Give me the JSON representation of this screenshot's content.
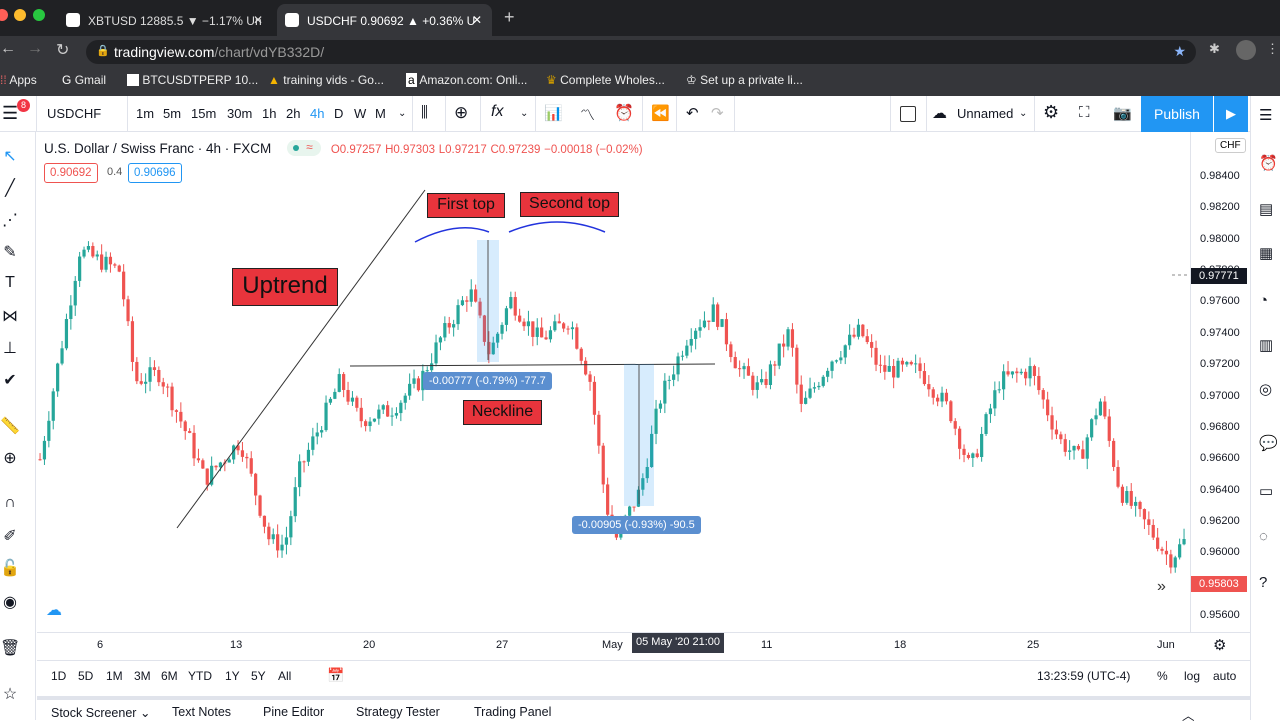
{
  "browser": {
    "tabs": [
      {
        "label": "XBTUSD 12885.5 ▼ −1.17% Un"
      },
      {
        "label": "USDCHF 0.90692 ▲ +0.36% U"
      }
    ],
    "url_domain": "tradingview.com",
    "url_path": "/chart/vdYB332D/",
    "bookmarks": [
      {
        "label": "Apps"
      },
      {
        "label": "Gmail"
      },
      {
        "label": "BTCUSDTPERP 10..."
      },
      {
        "label": "training vids - Go..."
      },
      {
        "label": "Amazon.com: Onli..."
      },
      {
        "label": "Complete Wholes..."
      },
      {
        "label": "Set up a private li..."
      }
    ]
  },
  "toolbar": {
    "notifications": "8",
    "symbol": "USDCHF",
    "intervals": [
      "1m",
      "5m",
      "15m",
      "30m",
      "1h",
      "2h",
      "4h",
      "D",
      "W",
      "M"
    ],
    "active_interval": "4h",
    "layout_name": "Unnamed",
    "publish": "Publish"
  },
  "legend": {
    "title": "U.S. Dollar / Swiss Franc · 4h · FXCM",
    "open": "O0.97257",
    "high": "H0.97303",
    "low": "L0.97217",
    "close": "C0.97239",
    "change": "−0.00018 (−0.02%)",
    "sell": "0.90692",
    "spread": "0.4",
    "buy": "0.90696"
  },
  "colors": {
    "up": "#26a69a",
    "down": "#ef5350",
    "accent": "#2196f3",
    "annotation": "#e8343c"
  },
  "annotations": {
    "uptrend": "Uptrend",
    "first_top": "First top",
    "second_top": "Second top",
    "neckline": "Neckline",
    "measure1": "-0.00777 (-0.79%) -77.7",
    "measure2": "-0.00905 (-0.93%) -90.5"
  },
  "chart_data": {
    "type": "candlestick",
    "symbol": "USDCHF",
    "timeframe": "4h",
    "y_ticks": [
      "0.98400",
      "0.98200",
      "0.98000",
      "0.97800",
      "0.97600",
      "0.97400",
      "0.97200",
      "0.97000",
      "0.96800",
      "0.96600",
      "0.96400",
      "0.96200",
      "0.96000",
      "0.95600"
    ],
    "ylim": [
      0.9555,
      0.9859
    ],
    "x_ticks": [
      "6",
      "13",
      "20",
      "27",
      "May",
      "11",
      "18",
      "25",
      "Jun"
    ],
    "crosshair_time": "05 May '20  21:00",
    "crosshair_price": "0.97771",
    "last_price": "0.95803",
    "currency": "CHF",
    "price_path": [
      [
        "2020-04-02T19",
        0.966
      ],
      [
        "2020-04-04T21",
        0.9793
      ],
      [
        "2020-04-07T00",
        0.978
      ],
      [
        "2020-04-07T19",
        0.971
      ],
      [
        "2020-04-09T02",
        0.9715
      ],
      [
        "2020-04-10T16",
        0.9672
      ],
      [
        "2020-04-11T11",
        0.9647
      ],
      [
        "2020-04-13T08",
        0.9672
      ],
      [
        "2020-04-14T21",
        0.9608
      ],
      [
        "2020-04-15T16",
        0.9605
      ],
      [
        "2020-04-16T11",
        0.9653
      ],
      [
        "2020-04-18T14",
        0.971
      ],
      [
        "2020-04-19T15",
        0.9685
      ],
      [
        "2020-04-21T05",
        0.9691
      ],
      [
        "2020-04-22T19",
        0.971
      ],
      [
        "2020-04-23T20",
        0.9736
      ],
      [
        "2020-04-25T10",
        0.9768
      ],
      [
        "2020-04-26T11",
        0.9727
      ],
      [
        "2020-04-27T13",
        0.9762
      ],
      [
        "2020-04-29T02",
        0.9736
      ],
      [
        "2020-04-30T16",
        0.9749
      ],
      [
        "2020-05-01T18",
        0.971
      ],
      [
        "2020-05-02T13",
        0.9634
      ],
      [
        "2020-05-03T01",
        0.9608
      ],
      [
        "2020-05-04T09",
        0.964
      ],
      [
        "2020-05-05T10",
        0.9698
      ],
      [
        "2020-05-07T00",
        0.9742
      ],
      [
        "2020-05-08T07",
        0.9755
      ],
      [
        "2020-05-09T14",
        0.9717
      ],
      [
        "2020-05-10T17",
        0.9704
      ],
      [
        "2020-05-12T06",
        0.9742
      ],
      [
        "2020-05-12T19",
        0.9691
      ],
      [
        "2020-05-14T09",
        0.9723
      ],
      [
        "2020-05-15T23",
        0.9742
      ],
      [
        "2020-05-17T00",
        0.9717
      ],
      [
        "2020-05-19T02",
        0.9717
      ],
      [
        "2020-05-20T16",
        0.9691
      ],
      [
        "2020-05-21T18",
        0.9653
      ],
      [
        "2020-05-23T07",
        0.971
      ],
      [
        "2020-05-24T22",
        0.9717
      ],
      [
        "2020-05-26T11",
        0.9672
      ],
      [
        "2020-05-27T12",
        0.966
      ],
      [
        "2020-05-28T14",
        0.9698
      ],
      [
        "2020-05-29T15",
        0.964
      ],
      [
        "2020-05-31T05",
        0.9615
      ],
      [
        "2020-06-01T06",
        0.9596
      ],
      [
        "2020-06-02T01",
        0.9608
      ],
      [
        "2020-06-02T07",
        0.958
      ]
    ],
    "neckline": 0.972
  },
  "range_buttons": [
    "1D",
    "5D",
    "1M",
    "3M",
    "6M",
    "YTD",
    "1Y",
    "5Y",
    "All"
  ],
  "status": {
    "time": "13:23:59 (UTC-4)",
    "percent": "%",
    "log": "log",
    "auto": "auto"
  },
  "panels": [
    "Stock Screener",
    "Text Notes",
    "Pine Editor",
    "Strategy Tester",
    "Trading Panel"
  ]
}
